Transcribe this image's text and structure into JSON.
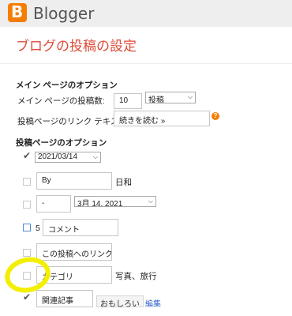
{
  "colors": {
    "brand_orange": "#f57d00",
    "title_red": "#dd4b39",
    "highlight": "#f2ef00",
    "link_blue": "#3366cc"
  },
  "header": {
    "logo_letter": "B",
    "brand": "Blogger",
    "logo_icon": "blogger-logo-icon"
  },
  "page": {
    "title": "ブログの投稿の設定"
  },
  "main_options": {
    "heading": "メイン ページのオプション",
    "posts_label": "メイン ページの投稿数:",
    "posts_value": "10",
    "posts_unit": "投稿",
    "readmore_label": "投稿ページのリンク テキスト:",
    "readmore_value": "続きを読む »",
    "help_icon": "help-icon",
    "help_glyph": "?"
  },
  "post_options": {
    "heading": "投稿ページのオプション",
    "date_header": {
      "checked": true,
      "value": "2021/03/14"
    },
    "posted_by": {
      "checked": false,
      "value": "By",
      "suffix": "日和"
    },
    "timestamp": {
      "checked": false,
      "value": "-",
      "format": "3月 14, 2021"
    },
    "comments": {
      "checked": false,
      "prefix": "5",
      "value": "コメント"
    },
    "backlinks": {
      "checked": false,
      "value": "この投稿へのリンク"
    },
    "labels": {
      "checked": false,
      "value": "カテゴリ",
      "suffix": "写真、旅行"
    },
    "reactions": {
      "checked": true,
      "value": "関連記事",
      "button": "おもしろい",
      "edit_link": "編集"
    }
  }
}
